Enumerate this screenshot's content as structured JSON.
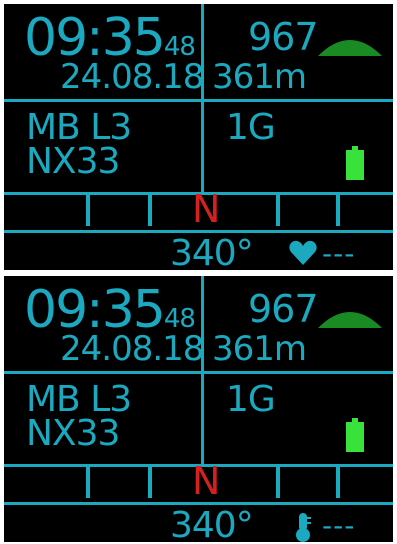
{
  "screens": [
    {
      "time_hm": "09:35",
      "time_sec": "48",
      "date": "24.08.18",
      "depth_value": "967",
      "distance": "361m",
      "mb_level": "MB L3",
      "gas": "NX33",
      "gas_count": "1G",
      "compass_north": "N",
      "heading": "340°",
      "status_value": "---",
      "status_icon": "heart-icon"
    },
    {
      "time_hm": "09:35",
      "time_sec": "48",
      "date": "24.08.18",
      "depth_value": "967",
      "distance": "361m",
      "mb_level": "MB L3",
      "gas": "NX33",
      "gas_count": "1G",
      "compass_north": "N",
      "heading": "340°",
      "status_value": "---",
      "status_icon": "thermometer-icon"
    }
  ],
  "colors": {
    "text": "#1aa9bf",
    "north": "#d62020",
    "battery": "#39e23b",
    "dome": "#1a8a22",
    "background": "#000000"
  }
}
